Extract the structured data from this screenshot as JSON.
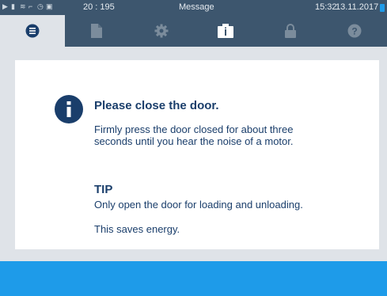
{
  "statusbar": {
    "icons": [
      "play-icon",
      "file-icon",
      "steam-icon",
      "chart-icon",
      "clock-icon",
      "lock-icon"
    ],
    "counter": "20 : 195",
    "title": "Message",
    "time": "15:32",
    "date": "13.11.2017",
    "colors": {
      "background": "#3d566e",
      "battery": "#1e9be9"
    }
  },
  "tabs": [
    {
      "icon": "menu-list-icon",
      "active": true
    },
    {
      "icon": "document-icon",
      "active": false
    },
    {
      "icon": "gear-icon",
      "active": false
    },
    {
      "icon": "info-card-icon",
      "active": false
    },
    {
      "icon": "lock-icon",
      "active": false
    },
    {
      "icon": "help-icon",
      "active": false
    }
  ],
  "message": {
    "heading": "Please close the door.",
    "body": "Firmly press the door closed for about three seconds until you hear the noise of a motor.",
    "tip_title": "TIP",
    "tip_body": "Only open the door for loading and unloading.",
    "tip_extra": "This saves energy.",
    "icon": "info-icon",
    "colors": {
      "text": "#1a3e6b",
      "icon": "#1a3e6b"
    }
  },
  "bottom_bar": {
    "color": "#1e9be9"
  }
}
